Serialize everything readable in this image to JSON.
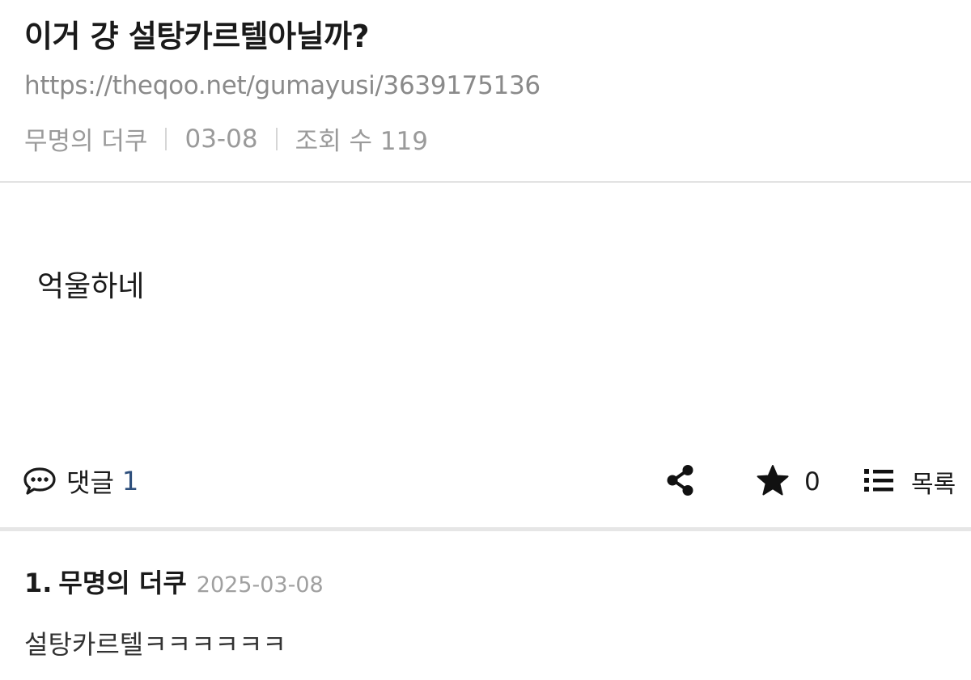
{
  "post": {
    "title": "이거 걍 설탕카르텔아닐까?",
    "url": "https://theqoo.net/gumayusi/3639175136",
    "author": "무명의 더쿠",
    "date": "03-08",
    "views": "조회 수 119",
    "body": "억울하네"
  },
  "actions": {
    "comment_label": "댓글",
    "comment_count": "1",
    "share_icon": "share-icon",
    "star_count": "0",
    "list_label": "목록"
  },
  "comments": [
    {
      "number": "1.",
      "author": "무명의 더쿠",
      "date": "2025-03-08",
      "text": "설탕카르텔ㅋㅋㅋㅋㅋㅋ"
    }
  ],
  "colors": {
    "accent_count": "#2e4f7c",
    "meta_gray": "#9a9a9a",
    "divider": "#e6e6e6"
  }
}
